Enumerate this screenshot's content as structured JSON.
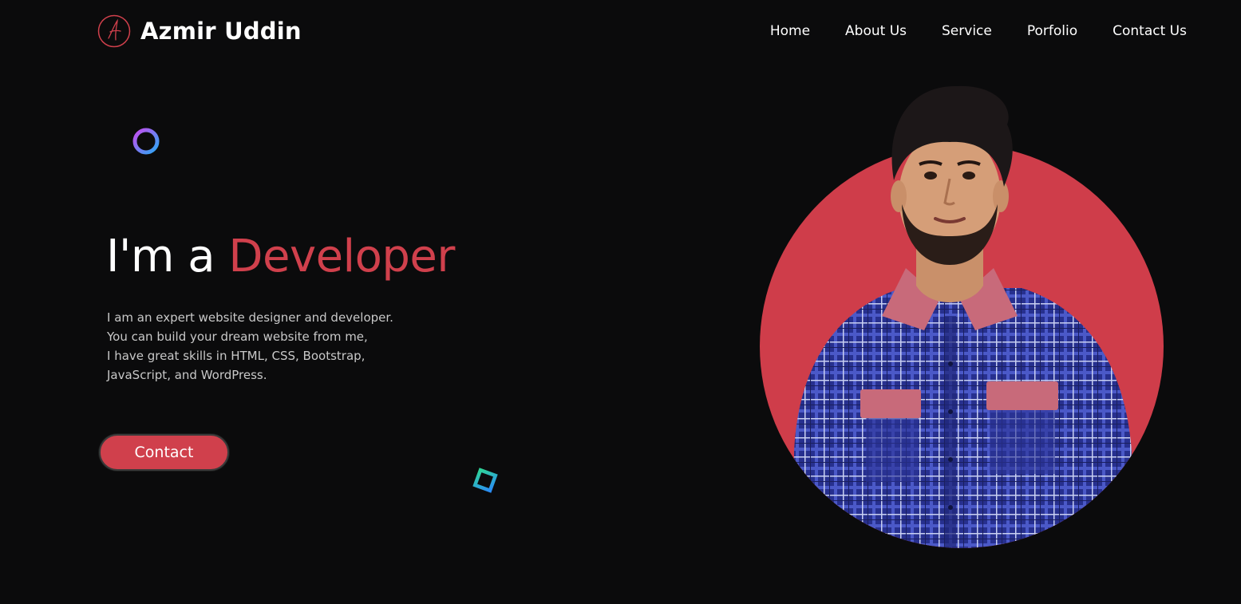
{
  "header": {
    "brand": "Azmir Uddin",
    "logo_icon": "signature-logo-icon",
    "nav": [
      {
        "label": "Home"
      },
      {
        "label": "About Us"
      },
      {
        "label": "Service"
      },
      {
        "label": "Porfolio"
      },
      {
        "label": "Contact Us"
      }
    ]
  },
  "hero": {
    "headline_prefix": "I'm a",
    "headline_highlight": "Developer",
    "intro_lines": [
      "I am an expert website designer and developer.",
      "You can build your dream website from me,",
      "I have great skills in HTML, CSS, Bootstrap,",
      "JavaScript, and WordPress."
    ],
    "cta_label": "Contact"
  },
  "colors": {
    "background": "#0b0b0c",
    "accent": "#d0404c",
    "text": "#ffffff",
    "muted_text": "#c8c8c8"
  }
}
